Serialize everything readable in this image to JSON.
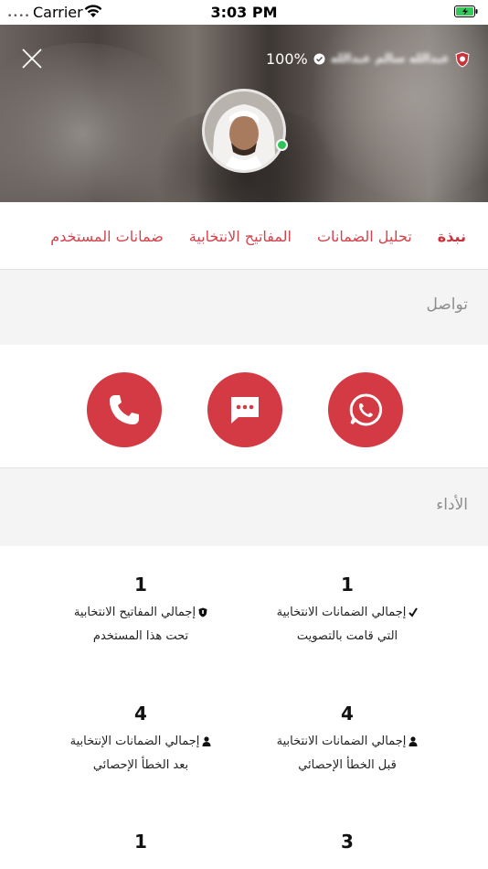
{
  "status_bar": {
    "signal": "••••",
    "carrier": "Carrier",
    "time": "3:03 PM"
  },
  "header": {
    "percent": "100%",
    "name": "عبدالله سالم عبدالله",
    "close_icon": "close-icon"
  },
  "tabs": [
    {
      "label": "نبذة",
      "active": true
    },
    {
      "label": "تحليل الضمانات"
    },
    {
      "label": "المفاتيح الانتخابية"
    },
    {
      "label": "ضمانات المستخدم"
    }
  ],
  "contact": {
    "title": "تواصل",
    "buttons": [
      "whatsapp-icon",
      "message-icon",
      "phone-icon"
    ]
  },
  "performance": {
    "title": "الأداء",
    "stats": [
      {
        "value": "1",
        "line1": "إجمالي الضمانات الانتخابية",
        "line2": "التي قامت بالتصويت",
        "icon": "check-icon"
      },
      {
        "value": "1",
        "line1": "إجمالي المفاتيح الانتخابية",
        "line2": "تحت هذا المستخدم",
        "icon": "shield-icon"
      },
      {
        "value": "4",
        "line1": "إجمالي الضمانات الانتخابية",
        "line2": "قبل الخطأ الإحصائي",
        "icon": "user-icon"
      },
      {
        "value": "4",
        "line1": "إجمالي الضمانات الإنتخابية",
        "line2": "بعد الخطأ الإحصائي",
        "icon": "user-icon"
      },
      {
        "value": "3",
        "line1": "",
        "line2": "",
        "icon": ""
      },
      {
        "value": "1",
        "line1": "",
        "line2": "",
        "icon": ""
      }
    ]
  },
  "colors": {
    "accent": "#d33a43",
    "online": "#2ec458",
    "section_bg": "#f4f4f4"
  }
}
